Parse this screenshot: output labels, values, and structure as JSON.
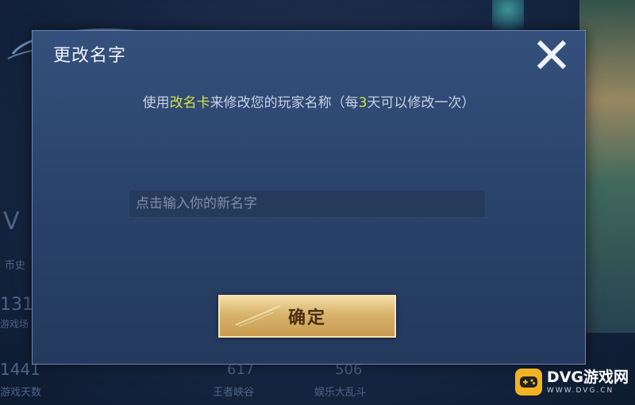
{
  "background": {
    "stat_left_1_value": "131",
    "stat_left_1_label": "游戏场",
    "stat_left_2_value": "1441",
    "stat_left_2_label": "游戏天数",
    "stat_mid_value": "617",
    "stat_mid_label": "王者峡谷",
    "stat_right_value": "506",
    "stat_right_label": "娱乐大乱斗",
    "side_label": "币史"
  },
  "dialog": {
    "title": "更改名字",
    "close_icon": "close-x-icon",
    "hint_part1": "使用",
    "hint_highlight1": "改名卡",
    "hint_part2": "来修改您的玩家名称（每",
    "hint_highlight2": "3",
    "hint_part3": "天可以修改一次）",
    "highlight_color": "#d7e34a",
    "input_value": "",
    "input_placeholder": "点击输入你的新名字",
    "confirm_label": "确定"
  },
  "watermark": {
    "main": "DVG游戏网",
    "sub": "WWW.DVG.CN",
    "icon": "gamepad-icon"
  }
}
